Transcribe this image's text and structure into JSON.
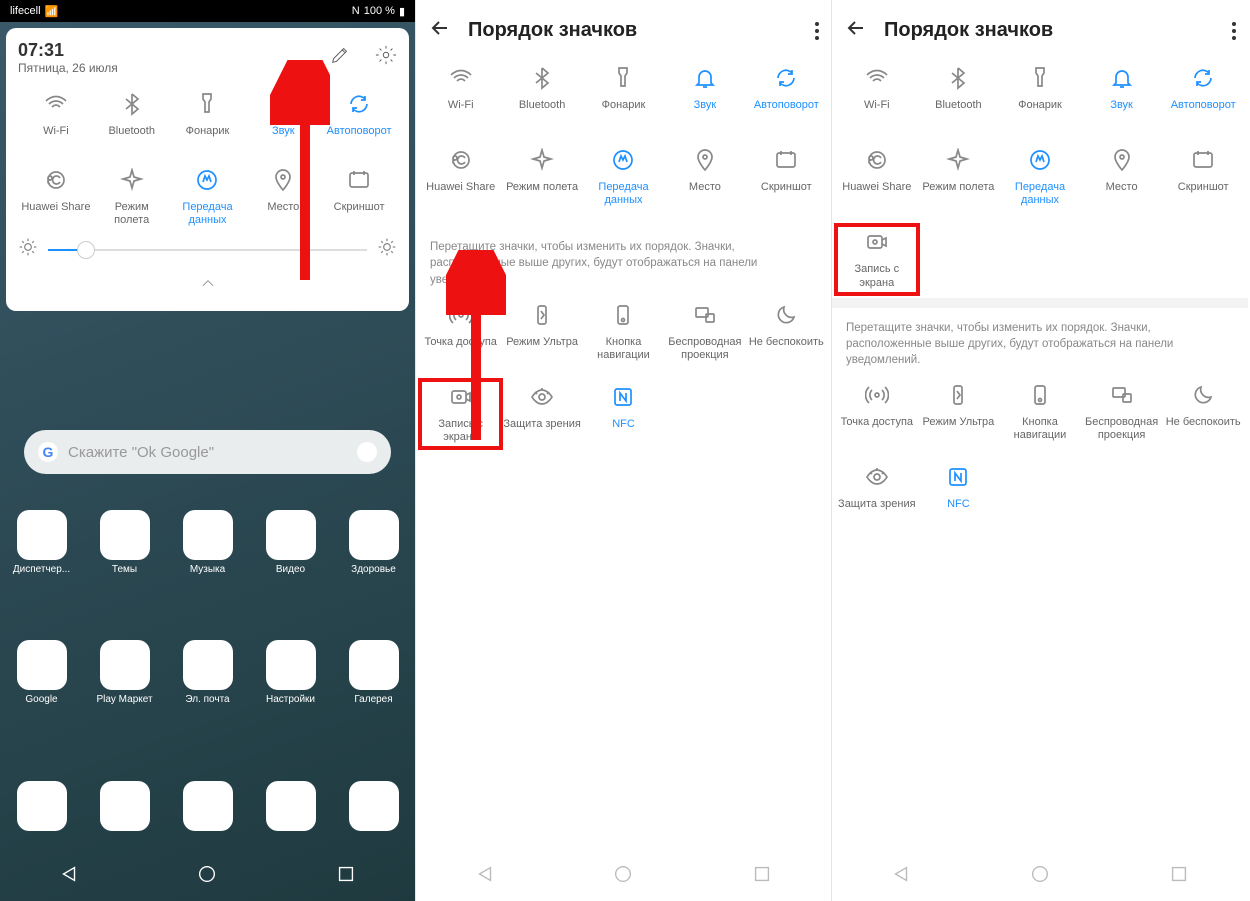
{
  "p1": {
    "status": {
      "carrier": "lifecell",
      "nfc": "N",
      "batt": "100 %"
    },
    "time": "07:31",
    "date": "Пятница, 26 июля",
    "toggles_r1": [
      {
        "label": "Wi-Fi",
        "on": false,
        "icon": "wifi"
      },
      {
        "label": "Bluetooth",
        "on": false,
        "icon": "bt"
      },
      {
        "label": "Фонарик",
        "on": false,
        "icon": "torch"
      },
      {
        "label": "Звук",
        "on": true,
        "icon": "bell"
      },
      {
        "label": "Автоповорот",
        "on": true,
        "icon": "rotate"
      }
    ],
    "toggles_r2": [
      {
        "label": "Huawei Share",
        "on": false,
        "icon": "share"
      },
      {
        "label": "Режим\nполета",
        "on": false,
        "icon": "plane"
      },
      {
        "label": "Передача\nданных",
        "on": true,
        "icon": "data"
      },
      {
        "label": "Место",
        "on": false,
        "icon": "pin"
      },
      {
        "label": "Скриншот",
        "on": false,
        "icon": "shot"
      }
    ],
    "search_placeholder": "Скажите \"Ok Google\"",
    "apps_r1": [
      "Диспетчер...",
      "Темы",
      "Музыка",
      "Видео",
      "Здоровье"
    ],
    "apps_r2": [
      "Google",
      "Play Маркет",
      "Эл. почта",
      "Настройки",
      "Галерея"
    ]
  },
  "p2": {
    "title": "Порядок значков",
    "toggles_r1": [
      {
        "label": "Wi-Fi",
        "on": false,
        "icon": "wifi"
      },
      {
        "label": "Bluetooth",
        "on": false,
        "icon": "bt"
      },
      {
        "label": "Фонарик",
        "on": false,
        "icon": "torch"
      },
      {
        "label": "Звук",
        "on": true,
        "icon": "bell"
      },
      {
        "label": "Автоповорот",
        "on": true,
        "icon": "rotate"
      }
    ],
    "toggles_r2": [
      {
        "label": "Huawei Share",
        "on": false,
        "icon": "share"
      },
      {
        "label": "Режим полета",
        "on": false,
        "icon": "plane"
      },
      {
        "label": "Передача\nданных",
        "on": true,
        "icon": "data"
      },
      {
        "label": "Место",
        "on": false,
        "icon": "pin"
      },
      {
        "label": "Скриншот",
        "on": false,
        "icon": "shot"
      }
    ],
    "hint": "Перетащите значки, чтобы изменить их порядок. Значки, расположенные выше других, будут отображаться на панели уведомлений.",
    "toggles_r3": [
      {
        "label": "Точка доступа",
        "on": false,
        "icon": "hotspot"
      },
      {
        "label": "Режим Ультра",
        "on": false,
        "icon": "ultra"
      },
      {
        "label": "Кнопка\nнавигации",
        "on": false,
        "icon": "navdot"
      },
      {
        "label": "Беспроводная\nпроекция",
        "on": false,
        "icon": "cast"
      },
      {
        "label": "Не беспокоить",
        "on": false,
        "icon": "dnd"
      }
    ],
    "toggles_r4": [
      {
        "label": "Запись с\nэкрана",
        "on": false,
        "icon": "rec",
        "hl": true
      },
      {
        "label": "Защита зрения",
        "on": false,
        "icon": "eye"
      },
      {
        "label": "NFC",
        "on": true,
        "icon": "nfc"
      }
    ]
  },
  "p3": {
    "title": "Порядок значков",
    "toggles_r1": [
      {
        "label": "Wi-Fi",
        "on": false,
        "icon": "wifi"
      },
      {
        "label": "Bluetooth",
        "on": false,
        "icon": "bt"
      },
      {
        "label": "Фонарик",
        "on": false,
        "icon": "torch"
      },
      {
        "label": "Звук",
        "on": true,
        "icon": "bell"
      },
      {
        "label": "Автоповорот",
        "on": true,
        "icon": "rotate"
      }
    ],
    "toggles_r2": [
      {
        "label": "Huawei Share",
        "on": false,
        "icon": "share"
      },
      {
        "label": "Режим полета",
        "on": false,
        "icon": "plane"
      },
      {
        "label": "Передача\nданных",
        "on": true,
        "icon": "data"
      },
      {
        "label": "Место",
        "on": false,
        "icon": "pin"
      },
      {
        "label": "Скриншот",
        "on": false,
        "icon": "shot"
      }
    ],
    "toggles_rX": [
      {
        "label": "Запись с\nэкрана",
        "on": false,
        "icon": "rec",
        "hl": true
      }
    ],
    "hint": "Перетащите значки, чтобы изменить их порядок. Значки, расположенные выше других, будут отображаться на панели уведомлений.",
    "toggles_r3": [
      {
        "label": "Точка доступа",
        "on": false,
        "icon": "hotspot"
      },
      {
        "label": "Режим Ультра",
        "on": false,
        "icon": "ultra"
      },
      {
        "label": "Кнопка\nнавигации",
        "on": false,
        "icon": "navdot"
      },
      {
        "label": "Беспроводная\nпроекция",
        "on": false,
        "icon": "cast"
      },
      {
        "label": "Не беспокоить",
        "on": false,
        "icon": "dnd"
      }
    ],
    "toggles_r4": [
      {
        "label": "Защита зрения",
        "on": false,
        "icon": "eye"
      },
      {
        "label": "NFC",
        "on": true,
        "icon": "nfc"
      }
    ]
  }
}
